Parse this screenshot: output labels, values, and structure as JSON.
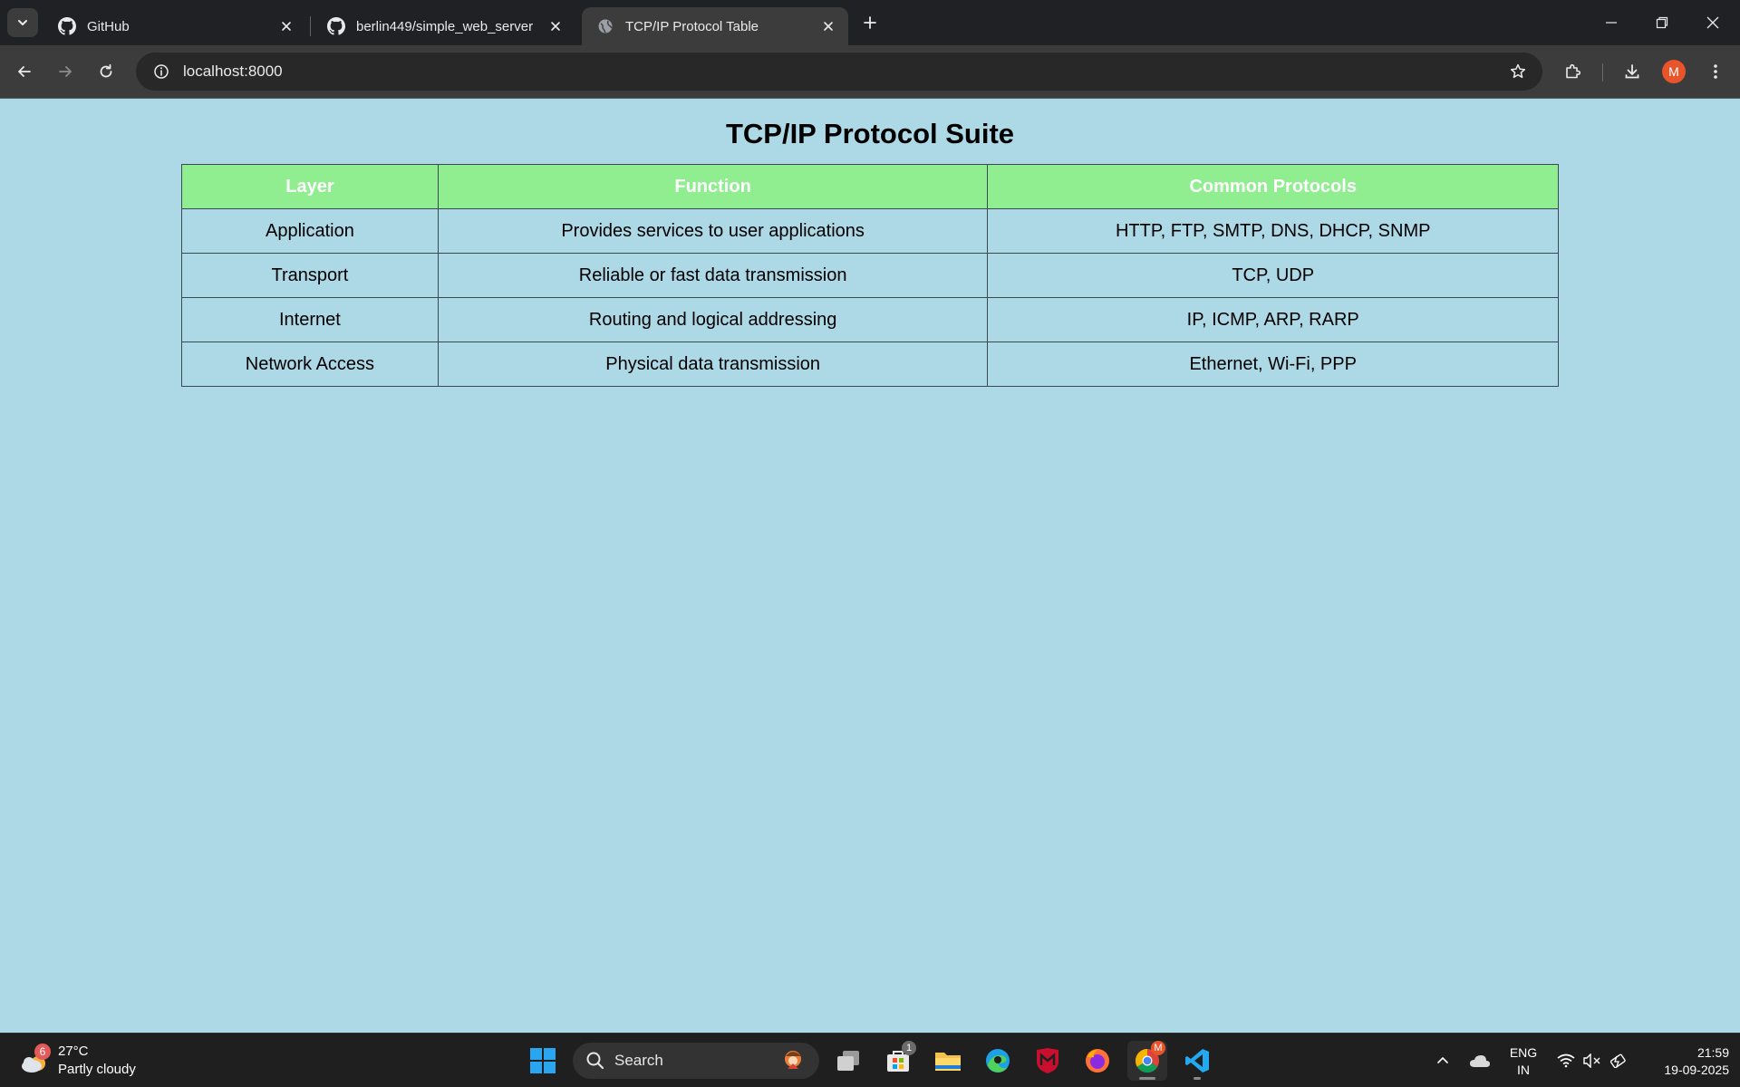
{
  "browser": {
    "tabs": [
      {
        "title": "GitHub",
        "icon": "github-icon",
        "active": false
      },
      {
        "title": "berlin449/simple_web_server",
        "icon": "github-icon",
        "active": false
      },
      {
        "title": "TCP/IP Protocol Table",
        "icon": "globe-icon",
        "active": true
      }
    ],
    "url": "localhost:8000",
    "profile_initial": "M"
  },
  "page": {
    "title": "TCP/IP Protocol Suite",
    "table": {
      "headers": [
        "Layer",
        "Function",
        "Common Protocols"
      ],
      "rows": [
        [
          "Application",
          "Provides services to user applications",
          "HTTP, FTP, SMTP, DNS, DHCP, SNMP"
        ],
        [
          "Transport",
          "Reliable or fast data transmission",
          "TCP, UDP"
        ],
        [
          "Internet",
          "Routing and logical addressing",
          "IP, ICMP, ARP, RARP"
        ],
        [
          "Network Access",
          "Physical data transmission",
          "Ethernet, Wi-Fi, PPP"
        ]
      ]
    }
  },
  "colors": {
    "page_background": "#add8e6",
    "header_background": "#90ee90",
    "header_text": "#ffffff"
  },
  "taskbar": {
    "weather": {
      "temp": "27°C",
      "condition": "Partly cloudy",
      "badge": "6"
    },
    "search_label": "Search",
    "store_badge": "1",
    "chrome_badge": "M",
    "language": [
      "ENG",
      "IN"
    ],
    "time": "21:59",
    "date": "19-09-2025"
  }
}
